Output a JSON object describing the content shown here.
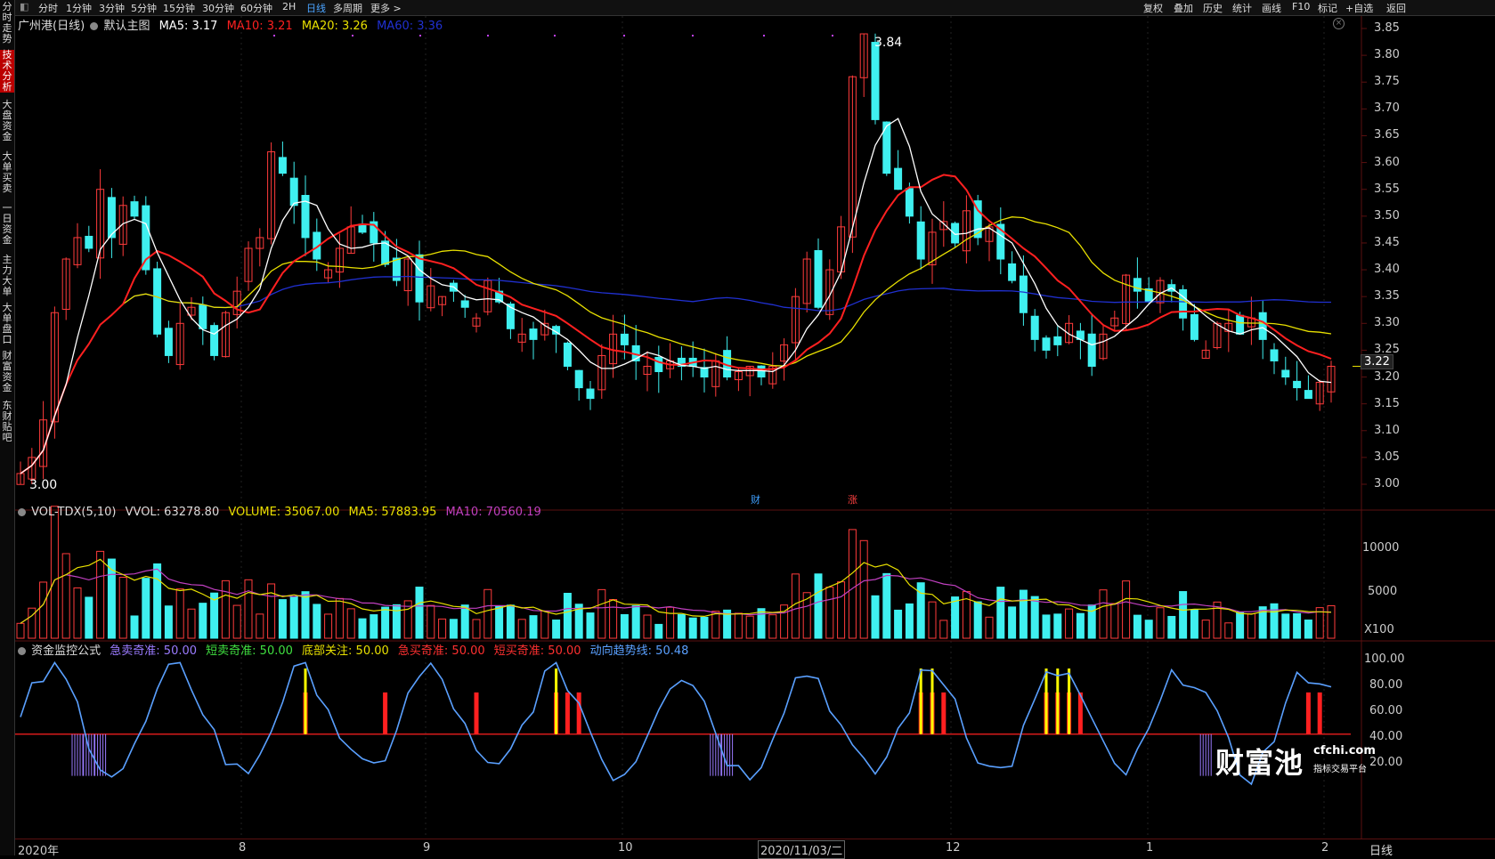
{
  "sidebar": {
    "tabs": [
      "分时走势",
      "技术分析",
      "大盘资金",
      "大单买卖",
      "一日资金",
      "主力大单",
      "大单盘口",
      "财富资金",
      "东财贴吧"
    ]
  },
  "toolbar": {
    "periods": [
      "分时",
      "1分钟",
      "3分钟",
      "5分钟",
      "15分钟",
      "30分钟",
      "60分钟",
      "2H",
      "日线",
      "多周期",
      "更多 >"
    ],
    "active": "日线",
    "right_items": [
      "复权",
      "叠加",
      "历史",
      "统计",
      "画线",
      "F10",
      "标记",
      "+自选",
      "返回"
    ]
  },
  "main_legend": {
    "title": "广州港(日线)",
    "template": "默认主图",
    "ma5": "MA5: 3.17",
    "ma10": "MA10: 3.21",
    "ma20": "MA20: 3.26",
    "ma60": "MA60: 3.36"
  },
  "price_annotations": {
    "high": "3.84",
    "low": "3.00",
    "current": "3.22"
  },
  "price_axis": [
    "3.85",
    "3.80",
    "3.75",
    "3.70",
    "3.65",
    "3.60",
    "3.55",
    "3.50",
    "3.45",
    "3.40",
    "3.35",
    "3.30",
    "3.25",
    "3.20",
    "3.15",
    "3.10",
    "3.05",
    "3.00"
  ],
  "markers": {
    "cai": "财",
    "zhang": "涨"
  },
  "vol_legend": {
    "title": "VOL-TDX(5,10)",
    "vvol": "VVOL: 63278.80",
    "volume": "VOLUME: 35067.00",
    "ma5": "MA5: 57883.95",
    "ma10": "MA10: 70560.19"
  },
  "vol_axis": [
    "10000",
    "5000",
    "X100"
  ],
  "fund_legend": {
    "title": "资金监控公式",
    "a": "急卖奇准: 50.00",
    "b": "短卖奇准: 50.00",
    "c": "底部关注: 50.00",
    "d": "急买奇准: 50.00",
    "e": "短买奇准: 50.00",
    "f": "动向趋势线: 50.48"
  },
  "fund_axis": [
    "100.00",
    "80.00",
    "60.00",
    "40.00",
    "20.00"
  ],
  "x_axis": [
    "2020年",
    "8",
    "9",
    "10",
    "2020/11/03/二",
    "12",
    "1",
    "2"
  ],
  "corner_label": "日线",
  "watermark": {
    "brand": "财富池",
    "url": "cfchi.com",
    "sub": "指标交易平台"
  },
  "colors": {
    "up": "#ff3b3b",
    "down": "#3ff0f0",
    "ma5": "#ffffff",
    "ma10": "#ff2020",
    "ma20": "#e8e000",
    "ma60": "#2030d0",
    "purple": "#c040c0",
    "blue_line": "#5aa0ff"
  },
  "chart_data": {
    "type": "candlestick",
    "title": "广州港(日线)",
    "ylim": [
      3.0,
      3.85
    ],
    "visible_high": 3.84,
    "visible_low": 3.0,
    "last_price": 3.22,
    "closes": [
      3.02,
      3.05,
      3.12,
      3.32,
      3.42,
      3.46,
      3.44,
      3.55,
      3.46,
      3.52,
      3.5,
      3.4,
      3.28,
      3.24,
      3.3,
      3.33,
      3.29,
      3.24,
      3.32,
      3.36,
      3.44,
      3.46,
      3.62,
      3.58,
      3.52,
      3.46,
      3.42,
      3.4,
      3.44,
      3.48,
      3.47,
      3.45,
      3.41,
      3.38,
      3.42,
      3.34,
      3.37,
      3.35,
      3.36,
      3.33,
      3.31,
      3.38,
      3.34,
      3.29,
      3.28,
      3.27,
      3.3,
      3.28,
      3.22,
      3.18,
      3.16,
      3.24,
      3.28,
      3.26,
      3.23,
      3.22,
      3.21,
      3.23,
      3.22,
      3.22,
      3.2,
      3.23,
      3.2,
      3.21,
      3.22,
      3.2,
      3.22,
      3.26,
      3.35,
      3.42,
      3.33,
      3.4,
      3.48,
      3.76,
      3.84,
      3.68,
      3.58,
      3.55,
      3.5,
      3.42,
      3.47,
      3.49,
      3.45,
      3.51,
      3.46,
      3.48,
      3.42,
      3.38,
      3.32,
      3.27,
      3.25,
      3.26,
      3.3,
      3.27,
      3.22,
      3.28,
      3.31,
      3.39,
      3.36,
      3.34,
      3.38,
      3.36,
      3.31,
      3.27,
      3.25,
      3.3,
      3.3,
      3.28,
      3.31,
      3.27,
      3.23,
      3.2,
      3.18,
      3.16,
      3.19,
      3.22
    ]
  }
}
